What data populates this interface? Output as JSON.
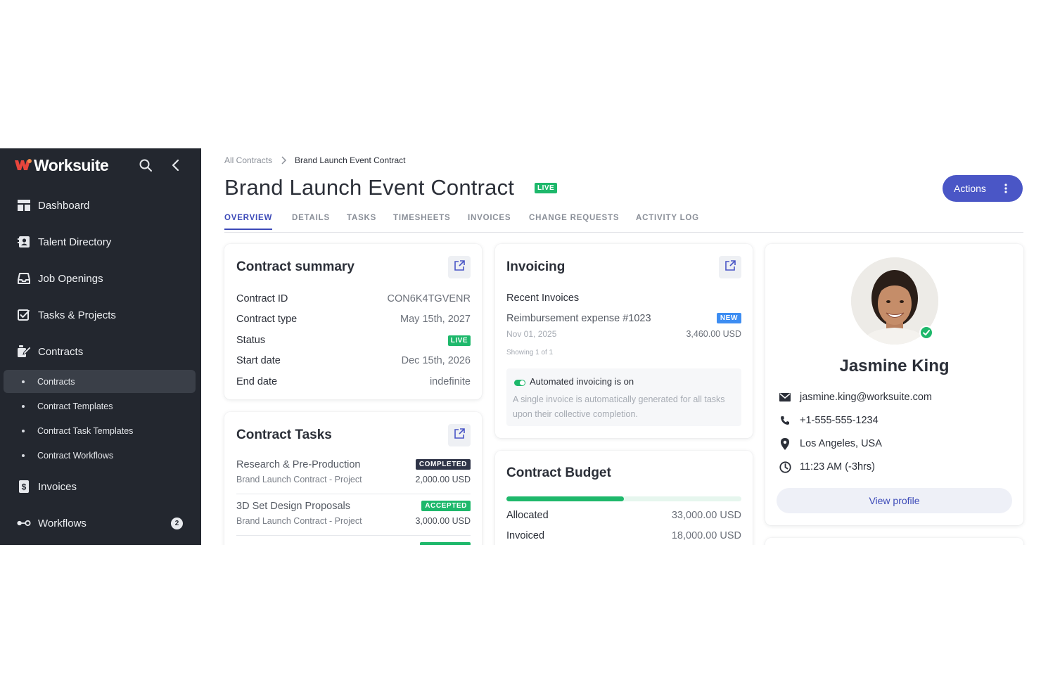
{
  "brand": {
    "name": "Worksuite",
    "accent": "#e8453c"
  },
  "sidebar": {
    "items": [
      {
        "label": "Dashboard",
        "icon": "dashboard-icon"
      },
      {
        "label": "Talent Directory",
        "icon": "contact-card-icon"
      },
      {
        "label": "Job Openings",
        "icon": "inbox-icon"
      },
      {
        "label": "Tasks & Projects",
        "icon": "checkbox-icon"
      },
      {
        "label": "Contracts",
        "icon": "contract-edit-icon"
      },
      {
        "label": "Invoices",
        "icon": "invoice-dollar-icon"
      },
      {
        "label": "Workflows",
        "icon": "workflow-toggle-icon",
        "badge": "2"
      }
    ],
    "subitems": [
      {
        "label": "Contracts",
        "active": true
      },
      {
        "label": "Contract Templates"
      },
      {
        "label": "Contract Task Templates"
      },
      {
        "label": "Contract Workflows"
      }
    ]
  },
  "breadcrumb": {
    "parent": "All Contracts",
    "current": "Brand Launch Event Contract"
  },
  "page": {
    "title": "Brand Launch Event Contract",
    "status_badge": "LIVE",
    "actions_label": "Actions"
  },
  "tabs": [
    "OVERVIEW",
    "DETAILS",
    "TASKS",
    "TIMESHEETS",
    "INVOICES",
    "CHANGE REQUESTS",
    "ACTIVITY LOG"
  ],
  "summary": {
    "title": "Contract summary",
    "rows": [
      {
        "key": "Contract ID",
        "value": "CON6K4TGVENR"
      },
      {
        "key": "Contract type",
        "value": "May 15th, 2027"
      },
      {
        "key": "Status",
        "value": "LIVE"
      },
      {
        "key": "Start date",
        "value": "Dec 15th, 2026"
      },
      {
        "key": "End date",
        "value": "indefinite"
      }
    ]
  },
  "tasks": {
    "title": "Contract Tasks",
    "items": [
      {
        "name": "Research & Pre-Production",
        "sub": "Brand Launch Contract - Project",
        "badge": "COMPLETED",
        "badge_color": "#2f3448",
        "amount": "2,000.00 USD"
      },
      {
        "name": "3D Set Design Proposals",
        "sub": "Brand Launch Contract - Project",
        "badge": "ACCEPTED",
        "badge_color": "#1eb86b",
        "amount": "3,000.00 USD"
      }
    ]
  },
  "invoicing": {
    "title": "Invoicing",
    "recent_label": "Recent Invoices",
    "invoice": {
      "name": "Reimbursement expense #1023",
      "date": "Nov 01, 2025",
      "badge": "NEW",
      "amount": "3,460.00 USD"
    },
    "showing": "Showing 1 of 1",
    "auto_title": "Automated invoicing is on",
    "auto_desc": "A single invoice is automatically generated for all tasks upon their collective completion."
  },
  "budget": {
    "title": "Contract Budget",
    "progress_fraction": 0.5,
    "rows": [
      {
        "key": "Allocated",
        "value": "33,000.00 USD"
      },
      {
        "key": "Invoiced",
        "value": "18,000.00 USD"
      }
    ]
  },
  "profile": {
    "name": "Jasmine King",
    "email": "jasmine.king@worksuite.com",
    "phone": "+1-555-555-1234",
    "location": "Los Angeles, USA",
    "time": "11:23 AM (-3hrs)",
    "view_label": "View profile"
  }
}
